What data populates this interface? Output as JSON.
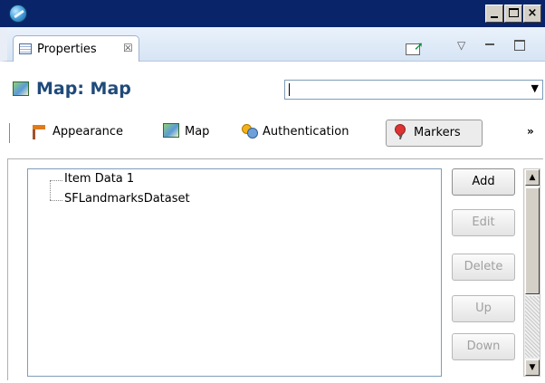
{
  "window": {
    "app_icon": "globe-icon",
    "controls": {
      "minimize": "minimize-icon",
      "maximize": "maximize-icon",
      "close": "×"
    }
  },
  "view": {
    "tab_label": "Properties",
    "tab_icon": "properties-icon",
    "tab_close": "☒",
    "view_menu": "▽"
  },
  "header": {
    "title": "Map: Map",
    "icon": "map-icon",
    "combo_value": "",
    "combo_dropdown": "▼"
  },
  "subtabs": [
    {
      "label": "Appearance",
      "icon": "signpost-icon",
      "active": false
    },
    {
      "label": "Map",
      "icon": "map-icon",
      "active": false
    },
    {
      "label": "Authentication",
      "icon": "users-icon",
      "active": false
    },
    {
      "label": "Markers",
      "icon": "marker-icon",
      "active": true
    }
  ],
  "overflow": "»",
  "tree": {
    "items": [
      {
        "label": "Item Data 1"
      },
      {
        "label": "SFLandmarksDataset"
      }
    ]
  },
  "buttons": {
    "add": "Add",
    "edit": "Edit",
    "delete": "Delete",
    "up": "Up",
    "down": "Down"
  },
  "scrollbar": {
    "up": "▲",
    "down": "▼"
  }
}
